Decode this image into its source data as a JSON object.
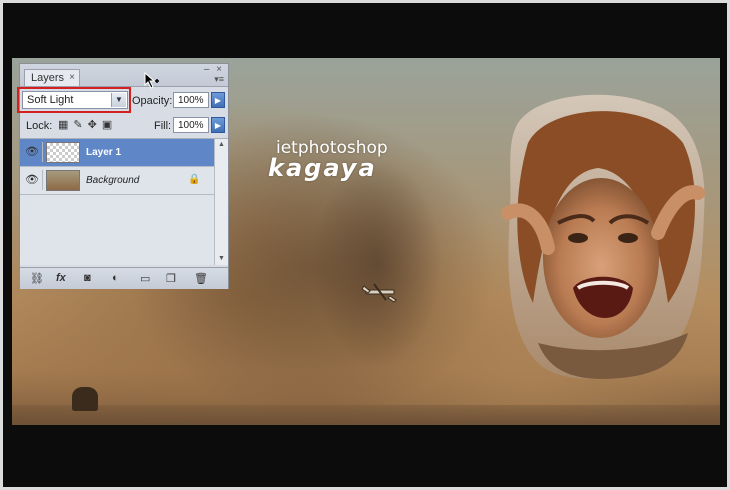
{
  "canvas": {
    "watermark_line1": "ietphotoshop",
    "watermark_line2": "kagaya"
  },
  "layers_panel": {
    "tab_label": "Layers",
    "tab_close": "×",
    "blend_mode": "Soft Light",
    "opacity_label": "Opacity:",
    "opacity_value": "100%",
    "lock_label": "Lock:",
    "fill_label": "Fill:",
    "fill_value": "100%",
    "layers": [
      {
        "name": "Layer 1",
        "selected": true,
        "visible": true
      },
      {
        "name": "Background",
        "selected": false,
        "visible": true,
        "locked": true
      }
    ],
    "bottom_icons": [
      "link-icon",
      "fx-icon",
      "mask-icon",
      "adjustment-icon",
      "group-folder-icon",
      "new-layer-icon",
      "trash-icon"
    ]
  },
  "colors": {
    "selection_blue": "#5f87c8",
    "highlight_red": "#d42020"
  }
}
